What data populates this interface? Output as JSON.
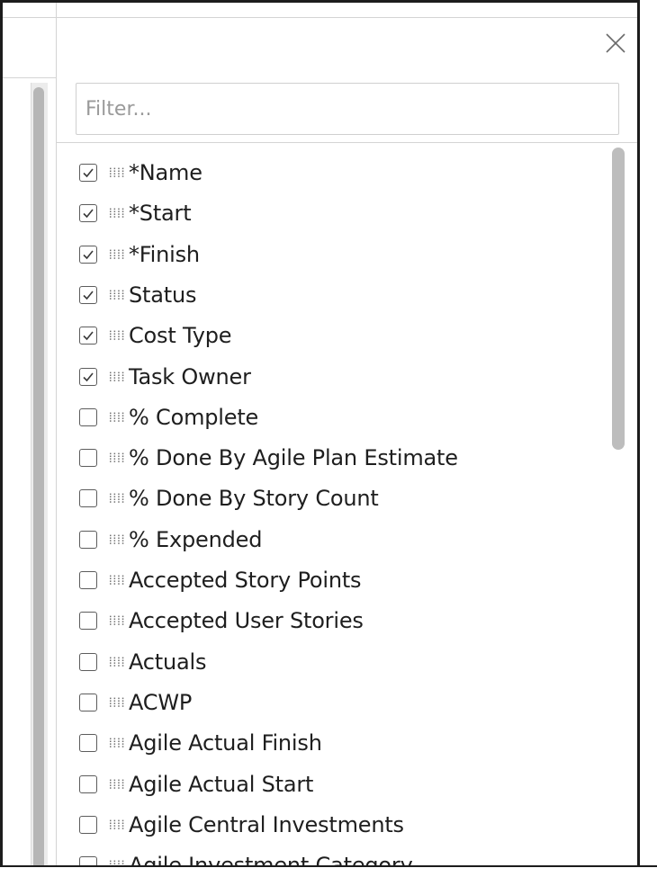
{
  "filter": {
    "placeholder": "Filter..."
  },
  "columns": [
    {
      "label": "*Name",
      "checked": true
    },
    {
      "label": "*Start",
      "checked": true
    },
    {
      "label": "*Finish",
      "checked": true
    },
    {
      "label": "Status",
      "checked": true
    },
    {
      "label": "Cost Type",
      "checked": true
    },
    {
      "label": "Task Owner",
      "checked": true
    },
    {
      "label": "% Complete",
      "checked": false
    },
    {
      "label": "% Done By Agile Plan Estimate",
      "checked": false
    },
    {
      "label": "% Done By Story Count",
      "checked": false
    },
    {
      "label": "% Expended",
      "checked": false
    },
    {
      "label": "Accepted Story Points",
      "checked": false
    },
    {
      "label": "Accepted User Stories",
      "checked": false
    },
    {
      "label": "Actuals",
      "checked": false
    },
    {
      "label": "ACWP",
      "checked": false
    },
    {
      "label": "Agile Actual Finish",
      "checked": false
    },
    {
      "label": "Agile Actual Start",
      "checked": false
    },
    {
      "label": "Agile Central Investments",
      "checked": false
    },
    {
      "label": "Agile Investment Category",
      "checked": false
    }
  ],
  "icons": {
    "close": "close-icon",
    "checkmark": "checkmark-icon",
    "grip": "drag-handle-icon"
  },
  "colors": {
    "frame": "#1c1c1c",
    "border": "#d4d4d4",
    "text": "#1e1e1e",
    "placeholder": "#9a9a9a",
    "scrollbar": "#bdbdbd"
  }
}
